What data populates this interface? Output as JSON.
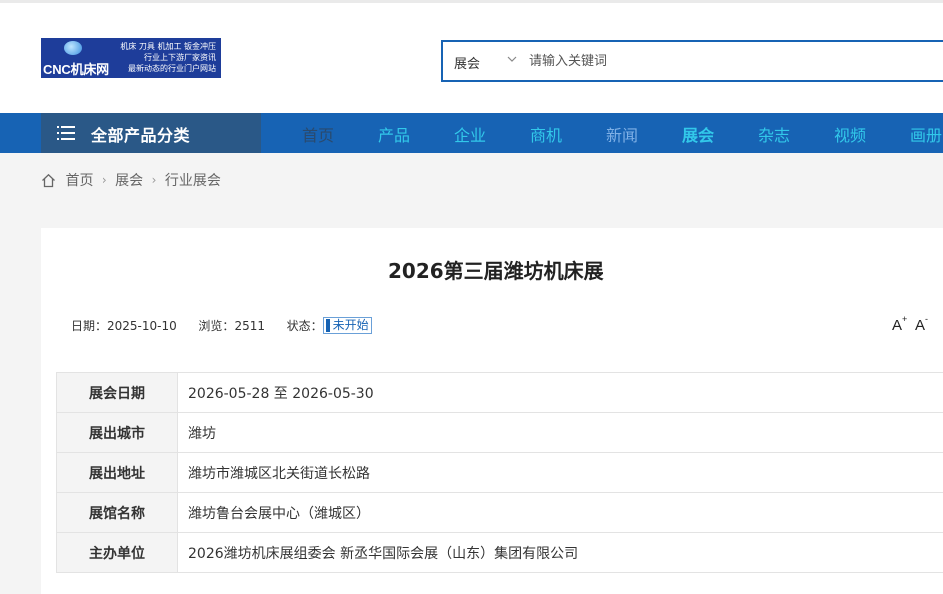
{
  "logo": {
    "main": "CNC机床网",
    "tagline": [
      "机床 刀具 机加工 钣金冲压",
      "行业上下游厂家资讯",
      "最新动态的行业门户网站"
    ]
  },
  "search": {
    "type": "展会",
    "placeholder": "请输入关键词"
  },
  "nav": {
    "all_categories": "全部产品分类",
    "items": [
      "首页",
      "产品",
      "企业",
      "商机",
      "新闻",
      "展会",
      "杂志",
      "视频",
      "画册"
    ],
    "active": "展会"
  },
  "breadcrumb": [
    "首页",
    "展会",
    "行业展会"
  ],
  "article": {
    "title": "2026第三届潍坊机床展",
    "date_label": "日期：",
    "date": "2025-10-10",
    "views_label": "浏览：",
    "views": "2511",
    "status_label": "状态：",
    "status": "未开始",
    "font_up": "A",
    "font_down": "A"
  },
  "details": [
    {
      "label": "展会日期",
      "value": "2026-05-28 至 2026-05-30"
    },
    {
      "label": "展出城市",
      "value": "潍坊"
    },
    {
      "label": "展出地址",
      "value": "潍坊市潍城区北关街道长松路"
    },
    {
      "label": "展馆名称",
      "value": "潍坊鲁台会展中心（潍城区）"
    },
    {
      "label": "主办单位",
      "value": "2026潍坊机床展组委会 新丞华国际会展（山东）集团有限公司"
    }
  ],
  "colors": {
    "nav_bg": "#1763b4",
    "nav_category_bg": "#2a5887",
    "nav_text": "#32c8ea",
    "nav_text_muted": "#7fb0e6",
    "nav_text_dim": "#2a4a6e"
  }
}
